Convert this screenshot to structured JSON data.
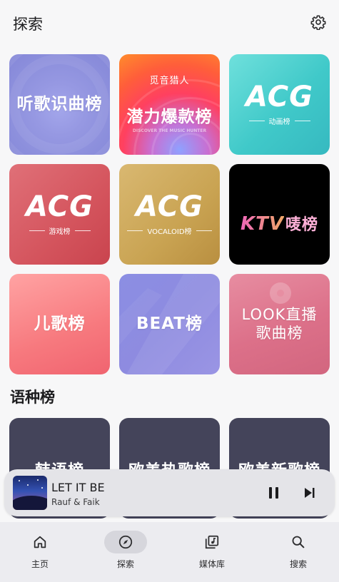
{
  "header": {
    "title": "探索",
    "settings_icon": "gear-icon"
  },
  "charts": {
    "c1": {
      "label": "听歌识曲榜"
    },
    "c2": {
      "small": "觅音猎人",
      "label": "潜力爆款榜",
      "tiny": "DISCOVER THE MUSIC HUNTER"
    },
    "c3": {
      "logo": "ACG",
      "sub": "动画榜"
    },
    "c4": {
      "logo": "ACG",
      "sub": "游戏榜"
    },
    "c5": {
      "logo": "ACG",
      "sub": "VOCALOID榜"
    },
    "c6": {
      "logo": "KTV",
      "suffix": "唛榜"
    },
    "c7": {
      "label": "儿歌榜"
    },
    "c8": {
      "label": "BEAT榜"
    },
    "c9": {
      "label": "LOOK直播\n歌曲榜"
    }
  },
  "section": {
    "title": "语种榜"
  },
  "language_charts": [
    "韩语榜",
    "欧美热歌榜",
    "欧美新歌榜"
  ],
  "player": {
    "title": "LET IT BE",
    "artist": "Rauf & Faik",
    "state": "playing"
  },
  "nav": {
    "items": [
      {
        "label": "主页",
        "icon": "home-icon"
      },
      {
        "label": "探索",
        "icon": "compass-icon",
        "active": true
      },
      {
        "label": "媒体库",
        "icon": "library-icon"
      },
      {
        "label": "搜索",
        "icon": "search-icon"
      }
    ]
  },
  "colors": {
    "background": "#f7f7f8",
    "navbar": "#ececf0",
    "player": "#e4e4e8"
  }
}
